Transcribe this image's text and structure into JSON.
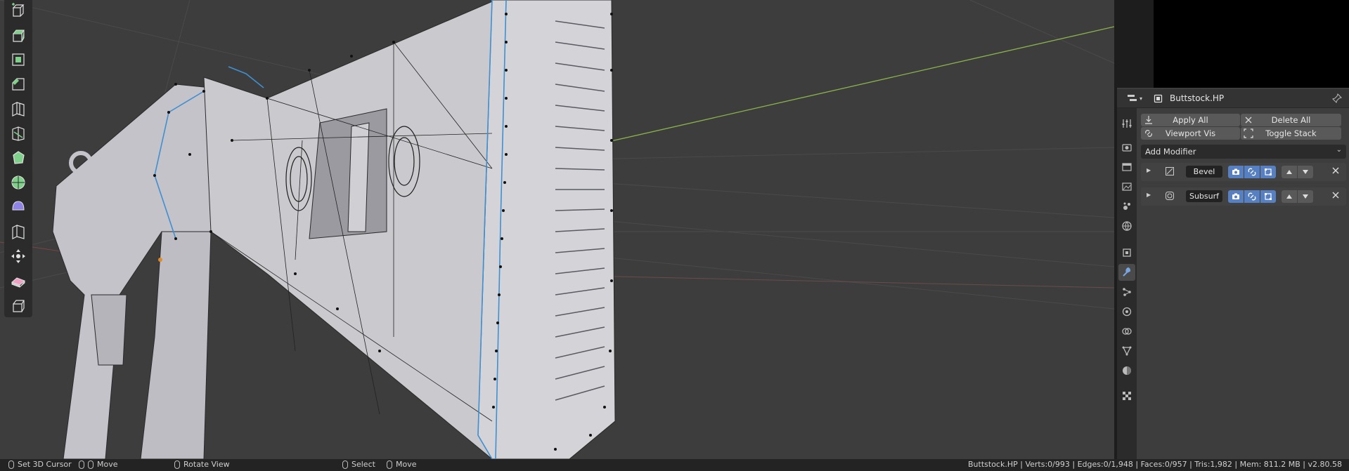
{
  "viewport": {
    "tools": [
      {
        "name": "add-cube-icon"
      },
      {
        "name": "extrude-region-icon"
      },
      {
        "name": "inset-faces-icon"
      },
      {
        "name": "bevel-icon"
      },
      {
        "name": "loop-cut-icon"
      },
      {
        "name": "knife-icon"
      },
      {
        "name": "poly-build-icon"
      },
      {
        "name": "spin-icon"
      },
      {
        "name": "smooth-icon"
      },
      {
        "name": "edge-slide-icon"
      },
      {
        "name": "shrink-fatten-icon"
      },
      {
        "name": "shear-icon"
      },
      {
        "name": "rip-region-icon"
      }
    ],
    "colors": {
      "background": "#3d3d3d",
      "mesh": "#c8c8cc",
      "seam": "#3f8fd1",
      "x_axis": "#8ab34a"
    }
  },
  "properties": {
    "object_name": "Buttstock.HP",
    "apply_all": "Apply All",
    "delete_all": "Delete All",
    "viewport_vis": "Viewport Vis",
    "toggle_stack": "Toggle Stack",
    "add_modifier": "Add Modifier",
    "modifiers": [
      {
        "name": "Bevel",
        "icon": "bevel-modifier-icon"
      },
      {
        "name": "Subsurf",
        "icon": "subsurf-modifier-icon"
      }
    ],
    "tabs": [
      "tool-icon",
      "render-icon",
      "output-icon",
      "view-layer-icon",
      "scene-icon",
      "world-icon",
      "object-icon",
      "modifier-icon",
      "particles-icon",
      "physics-icon",
      "constraints-icon",
      "data-icon",
      "material-icon",
      "texture-icon"
    ],
    "accent": "#5680c2"
  },
  "statusbar": {
    "left": [
      {
        "label": "Set 3D Cursor"
      },
      {
        "label": "Move"
      },
      {
        "label": "Rotate View"
      },
      {
        "label": "Select"
      },
      {
        "label": "Move"
      }
    ],
    "stats": "Buttstock.HP | Verts:0/993 | Edges:0/1,948 | Faces:0/957 | Tris:1,982 | Mem: 811.2 MB | v2.80.58"
  }
}
